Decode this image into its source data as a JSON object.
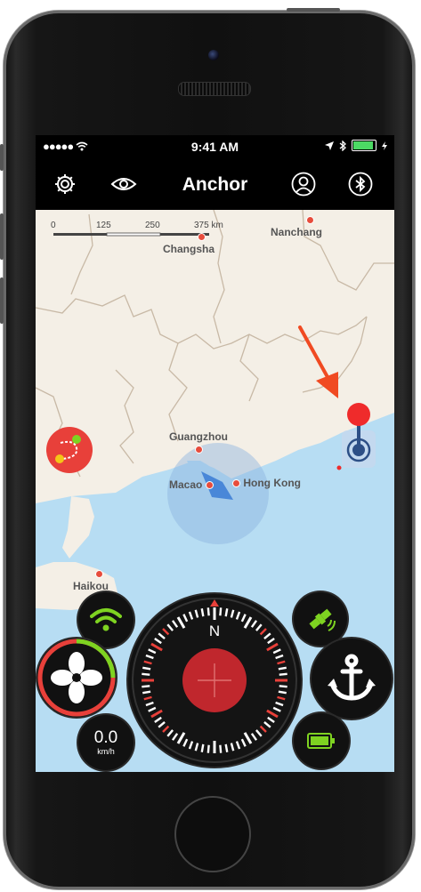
{
  "status_bar": {
    "signal": "●●●●● ",
    "time": "9:41 AM",
    "location_icon": "location-arrow-icon",
    "bluetooth_icon": "bluetooth-icon"
  },
  "nav": {
    "title": "Anchor",
    "icons": [
      "gear-icon",
      "eye-icon",
      "user-icon",
      "bluetooth-icon"
    ]
  },
  "map": {
    "scale": {
      "labels": [
        "0",
        "125",
        "250",
        "375 km"
      ]
    },
    "cities": {
      "nanchang": "Nanchang",
      "changsha": "Changsha",
      "guangzhou": "Guangzhou",
      "macao": "Macao",
      "hong_kong": "Hong Kong",
      "haikou": "Haikou"
    },
    "colors": {
      "land": "#f4efe6",
      "water": "#b7ddf3",
      "border": "#c8b9a6"
    }
  },
  "controls": {
    "speed_value": "0.0",
    "speed_unit": "km/h",
    "compass_letter": "N",
    "icons": {
      "wifi": "wifi-icon",
      "satellite": "satellite-icon",
      "fan": "fan-icon",
      "anchor": "anchor-icon",
      "battery": "battery-icon",
      "route": "route-icon"
    },
    "colors": {
      "accent_green": "#7ed321",
      "compass_red": "#c0272d",
      "ring_red": "#e8403a"
    }
  }
}
